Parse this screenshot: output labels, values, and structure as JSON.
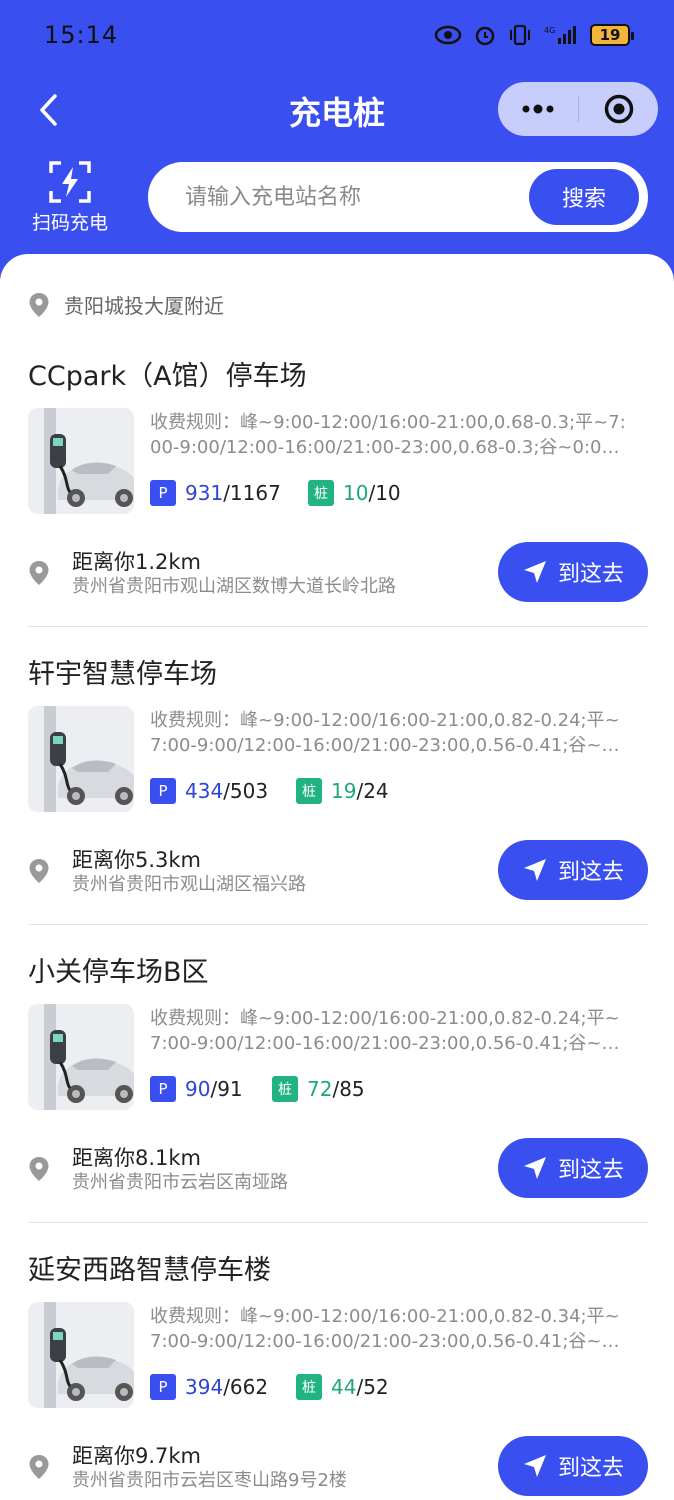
{
  "status_bar": {
    "time": "15:14",
    "battery": "19"
  },
  "nav": {
    "title": "充电桩"
  },
  "scan": {
    "label": "扫码充电"
  },
  "search": {
    "placeholder": "请输入充电站名称",
    "button": "搜索"
  },
  "location": {
    "text": "贵阳城投大厦附近"
  },
  "stations": [
    {
      "name": "CCpark（A馆）停车场",
      "rule_line1": "收费规则：峰~9:00-12:00/16:00-21:00,0.68-0.3;平~7:",
      "rule_line2": "00-9:00/12:00-16:00/21:00-23:00,0.68-0.3;谷~0:0…",
      "parking_free": "931",
      "parking_total": "/1167",
      "pile_free": "10",
      "pile_total": "/10",
      "distance": "距离你1.2km",
      "address": "贵州省贵阳市观山湖区数博大道长岭北路",
      "go_label": "到这去"
    },
    {
      "name": "轩宇智慧停车场",
      "rule_line1": "收费规则：峰~9:00-12:00/16:00-21:00,0.82-0.24;平~",
      "rule_line2": "7:00-9:00/12:00-16:00/21:00-23:00,0.56-0.41;谷~…",
      "parking_free": "434",
      "parking_total": "/503",
      "pile_free": "19",
      "pile_total": "/24",
      "distance": "距离你5.3km",
      "address": "贵州省贵阳市观山湖区福兴路",
      "go_label": "到这去"
    },
    {
      "name": "小关停车场B区",
      "rule_line1": "收费规则：峰~9:00-12:00/16:00-21:00,0.82-0.24;平~",
      "rule_line2": "7:00-9:00/12:00-16:00/21:00-23:00,0.56-0.41;谷~…",
      "parking_free": "90",
      "parking_total": "/91",
      "pile_free": "72",
      "pile_total": "/85",
      "distance": "距离你8.1km",
      "address": "贵州省贵阳市云岩区南垭路",
      "go_label": "到这去"
    },
    {
      "name": "延安西路智慧停车楼",
      "rule_line1": "收费规则：峰~9:00-12:00/16:00-21:00,0.82-0.34;平~",
      "rule_line2": "7:00-9:00/12:00-16:00/21:00-23:00,0.56-0.41;谷~…",
      "parking_free": "394",
      "parking_total": "/662",
      "pile_free": "44",
      "pile_total": "/52",
      "distance": "距离你9.7km",
      "address": "贵州省贵阳市云岩区枣山路9号2楼",
      "go_label": "到这去"
    }
  ],
  "badges": {
    "parking": "P",
    "pile": "桩"
  },
  "colors": {
    "brand_blue": "#3a4ff0",
    "pile_green": "#22b383"
  }
}
